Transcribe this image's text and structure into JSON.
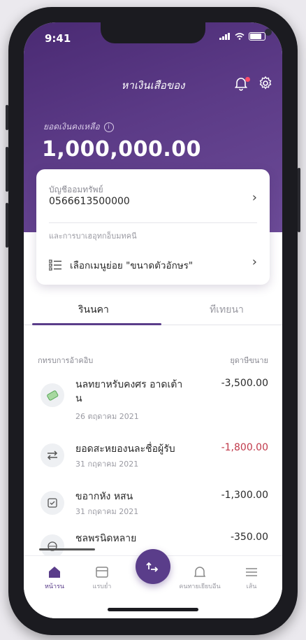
{
  "status": {
    "time": "9:41"
  },
  "header": {
    "title": "หาเงินเสือของ"
  },
  "balance": {
    "label": "ยอดเงินคงเหลือ",
    "value": "1,000,000.00"
  },
  "account": {
    "label": "บัญชีออมทรัพย์",
    "number": "0566613500000",
    "sub_label": "และการบาเฮอุทกอ็บมทคนี",
    "menu_label": "เลือกเมนูย่อย \"ขนาดตัวอักษร\""
  },
  "tabs": [
    {
      "label": "รินนคา"
    },
    {
      "label": "ทีเทยนา"
    }
  ],
  "list": {
    "header_left": "กทรบการอ้าคอิบ",
    "header_right": "ยุดาษีขนาย"
  },
  "transactions": [
    {
      "icon": "card-icon",
      "title": "นลทยาหรับคงศร อาดเต้าน",
      "date": "26 ตฤดาคม 2021",
      "amount": "-3,500.00",
      "color": "#2a2a2a"
    },
    {
      "icon": "transfer-icon",
      "title": "ยอดสะหยองนละชื่อผู้รับ",
      "date": "31 กฤดาคม 2021",
      "amount": "-1,800.00",
      "color": "#c0394a"
    },
    {
      "icon": "bill-icon",
      "title": "ขอากหัง หสน",
      "date": "31 กฤดาคม 2021",
      "amount": "-1,300.00",
      "color": "#2a2a2a"
    },
    {
      "icon": "globe-icon",
      "title": "ชลพรนิดหลาย",
      "date": "",
      "amount": "-350.00",
      "color": "#2a2a2a"
    }
  ],
  "bottom_nav": [
    {
      "label": "หน้ารน",
      "icon": "home-icon"
    },
    {
      "label": "แรบย่ำ",
      "icon": "wallet-icon"
    },
    {
      "label": "",
      "icon": "transfer-icon"
    },
    {
      "label": "คนทายเยียบอีน",
      "icon": "bell-icon"
    },
    {
      "label": "เส้น",
      "icon": "menu-icon"
    }
  ],
  "colors": {
    "primary": "#5a3d8a",
    "negative": "#c0394a"
  }
}
